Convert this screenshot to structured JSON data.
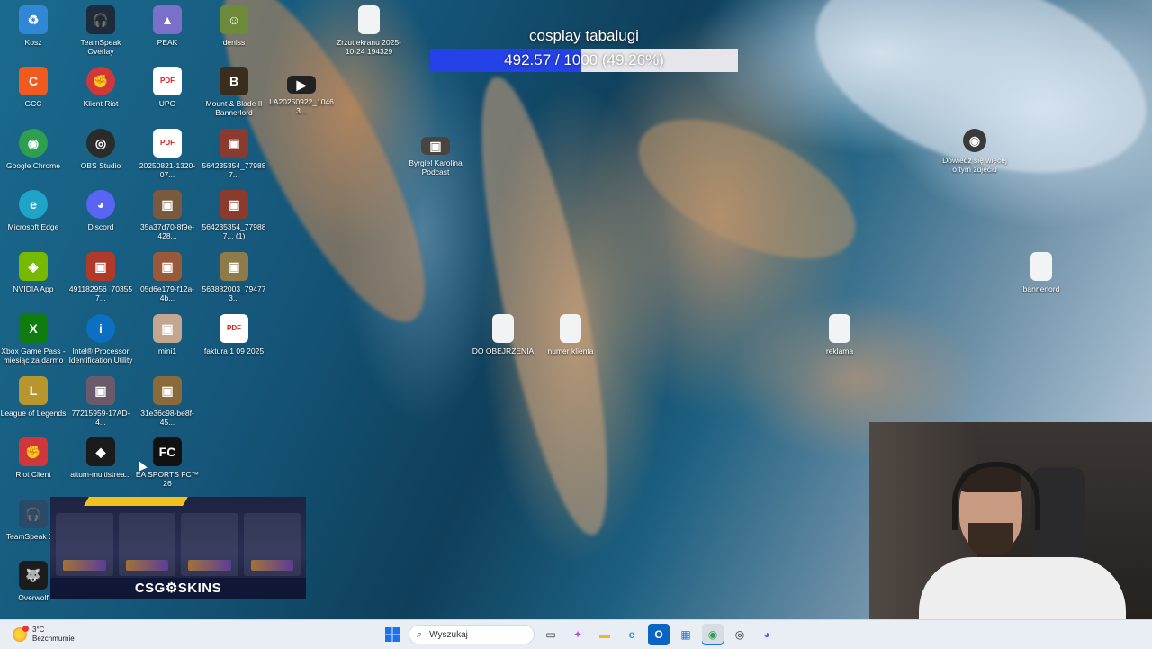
{
  "desktop": {
    "icons": [
      {
        "label": "Kosz",
        "icon": "recycle-bin-icon",
        "glyph": "♻",
        "color": "#2f87d6"
      },
      {
        "label": "TeamSpeak Overlay",
        "icon": "teamspeak-icon",
        "glyph": "🎧",
        "color": "#1e2b3a"
      },
      {
        "label": "PEAK",
        "icon": "peak-game-icon",
        "glyph": "▲",
        "color": "#7a6fc9"
      },
      {
        "label": "deniss",
        "icon": "character-image-icon",
        "glyph": "☺",
        "color": "#6d8a3a"
      },
      {
        "label": "GCC",
        "icon": "gcc-icon",
        "glyph": "C",
        "color": "#f05a1e"
      },
      {
        "label": "Klient Riot",
        "icon": "riot-client-icon",
        "glyph": "✊",
        "color": "#d13639"
      },
      {
        "label": "UPO",
        "icon": "pdf-icon",
        "glyph": "PDF",
        "color": "#ffffff"
      },
      {
        "label": "Mount & Blade II Bannerlord",
        "icon": "bannerlord-icon",
        "glyph": "B",
        "color": "#3a2d1e"
      },
      {
        "label": "Google Chrome",
        "icon": "chrome-icon",
        "glyph": "◉",
        "color": "#2e9e4f"
      },
      {
        "label": "OBS Studio",
        "icon": "obs-icon",
        "glyph": "◎",
        "color": "#2b2b2b"
      },
      {
        "label": "20250821-1320-07...",
        "icon": "pdf-icon",
        "glyph": "PDF",
        "color": "#ffffff"
      },
      {
        "label": "564235354_779887...",
        "icon": "photo-thumbnail-icon",
        "glyph": "▣",
        "color": "#8a3b2e"
      },
      {
        "label": "Microsoft Edge",
        "icon": "edge-icon",
        "glyph": "e",
        "color": "#1fa3c7"
      },
      {
        "label": "Discord",
        "icon": "discord-icon",
        "glyph": "◕",
        "color": "#5865f2"
      },
      {
        "label": "35a37d70-8f9e-428...",
        "icon": "photo-thumbnail-icon",
        "glyph": "▣",
        "color": "#7a5a3e"
      },
      {
        "label": "564235354_779887... (1)",
        "icon": "photo-thumbnail-icon",
        "glyph": "▣",
        "color": "#8a3b2e"
      },
      {
        "label": "NVIDIA App",
        "icon": "nvidia-icon",
        "glyph": "◈",
        "color": "#76b900"
      },
      {
        "label": "491182956_703557...",
        "icon": "photo-thumbnail-icon",
        "glyph": "▣",
        "color": "#b03a2a"
      },
      {
        "label": "05d6e179-f12a-4b...",
        "icon": "photo-thumbnail-icon",
        "glyph": "▣",
        "color": "#9a5a3a"
      },
      {
        "label": "563882003_794773...",
        "icon": "photo-thumbnail-icon",
        "glyph": "▣",
        "color": "#8f7a4a"
      },
      {
        "label": "Xbox Game Pass - miesiąc za darmo",
        "icon": "xbox-icon",
        "glyph": "X",
        "color": "#107c10"
      },
      {
        "label": "Intel® Processor Identification Utility",
        "icon": "intel-icon",
        "glyph": "i",
        "color": "#0b6fc2"
      },
      {
        "label": "mini1",
        "icon": "photo-thumbnail-icon",
        "glyph": "▣",
        "color": "#c2a690"
      },
      {
        "label": "faktura 1 09 2025",
        "icon": "pdf-icon",
        "glyph": "PDF",
        "color": "#ffffff"
      },
      {
        "label": "League of Legends",
        "icon": "league-of-legends-icon",
        "glyph": "L",
        "color": "#b8962e"
      },
      {
        "label": "77215959-17AD-4...",
        "icon": "photo-thumbnail-icon",
        "glyph": "▣",
        "color": "#6a5a6a"
      },
      {
        "label": "31e36c98-be8f-45...",
        "icon": "photo-thumbnail-icon",
        "glyph": "▣",
        "color": "#8a6a3a"
      },
      {
        "label": "Riot Client",
        "icon": "riot-client-icon",
        "glyph": "✊",
        "color": "#d13639"
      },
      {
        "label": "aitum-multistrea...",
        "icon": "aitum-icon",
        "glyph": "◆",
        "color": "#1b1b1b"
      },
      {
        "label": "EA SPORTS FC™ 26",
        "icon": "ea-sports-fc-icon",
        "glyph": "FC",
        "color": "#111111"
      },
      {
        "label": "TeamSpeak 3 C",
        "icon": "teamspeak-icon",
        "glyph": "🎧",
        "color": "#2a4a6a"
      },
      {
        "label": "Overwolf",
        "icon": "overwolf-icon",
        "glyph": "🐺",
        "color": "#1c1c1c"
      },
      {
        "label": "Zrzut ekranu 2025-10-24 194329",
        "icon": "file-icon",
        "glyph": "",
        "color": "#f1f3f5"
      },
      {
        "label": "LA20250922_10463...",
        "icon": "video-thumbnail-icon",
        "glyph": "▶",
        "color": "#222222"
      },
      {
        "label": "Byrgiel Karolina Podcast",
        "icon": "photo-thumbnail-icon",
        "glyph": "▣",
        "color": "#4a4440"
      },
      {
        "label": "DO OBEJRZENIA",
        "icon": "file-icon",
        "glyph": "",
        "color": "#f1f3f5"
      },
      {
        "label": "numer klienta",
        "icon": "file-icon",
        "glyph": "",
        "color": "#f1f3f5"
      },
      {
        "label": "reklama",
        "icon": "file-icon",
        "glyph": "",
        "color": "#f1f3f5"
      },
      {
        "label": "Dowiedz się więcej o tym zdjęciu",
        "icon": "camera-info-icon",
        "glyph": "◉",
        "color": "#3a3a3a"
      },
      {
        "label": "bannerlord",
        "icon": "file-icon",
        "glyph": "",
        "color": "#f1f3f5"
      }
    ]
  },
  "overlay": {
    "goal_title": "cosplay tabalugi",
    "goal_text": "492.57 / 1000 (49.26%)",
    "goal_progress": 0.4926,
    "fill_color": "#2442e8"
  },
  "ad": {
    "brand": "CSG⚙SKINS"
  },
  "taskbar": {
    "weather_temp": "3°C",
    "weather_desc": "Bezchmurnie",
    "search_placeholder": "Wyszukaj",
    "apps": [
      {
        "name": "task-view-icon",
        "glyph": "▭",
        "color": "#333333"
      },
      {
        "name": "copilot-icon",
        "glyph": "✦",
        "color": "#c04fd6"
      },
      {
        "name": "file-explorer-icon",
        "glyph": "▬",
        "color": "#f2b61c"
      },
      {
        "name": "edge-icon",
        "glyph": "e",
        "color": "#1fa3c7"
      },
      {
        "name": "outlook-icon",
        "glyph": "O",
        "color": "#0a64c2"
      },
      {
        "name": "store-icon",
        "glyph": "▦",
        "color": "#1a6fd1"
      },
      {
        "name": "chrome-icon",
        "glyph": "◉",
        "color": "#2e9e4f"
      },
      {
        "name": "obs-icon",
        "glyph": "◎",
        "color": "#2b2b2b"
      },
      {
        "name": "discord-icon",
        "glyph": "◕",
        "color": "#5865f2"
      }
    ]
  }
}
